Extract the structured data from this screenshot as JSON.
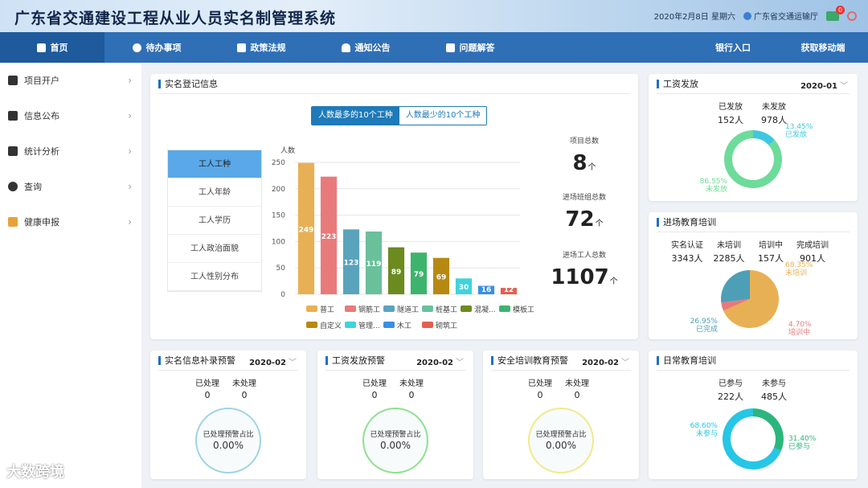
{
  "header": {
    "title": "广东省交通建设工程从业人员实名制管理系统",
    "date": "2020年2月8日",
    "weekday": "星期六",
    "org": "广东省交通运输厅",
    "msg_count": "0"
  },
  "nav": {
    "items": [
      "首页",
      "待办事项",
      "政策法规",
      "通知公告",
      "问题解答"
    ],
    "right": [
      "银行入口",
      "获取移动端"
    ]
  },
  "sidebar": {
    "items": [
      "项目开户",
      "信息公布",
      "统计分析",
      "查询",
      "健康申报"
    ]
  },
  "watermark": "大数跨境",
  "main": {
    "title": "实名登记信息",
    "tabs": [
      "人数最多的10个工种",
      "人数最少的10个工种"
    ],
    "categories": [
      "工人工种",
      "工人年龄",
      "工人学历",
      "工人政治面貌",
      "工人性别分布"
    ],
    "stats": [
      {
        "label": "项目总数",
        "value": "8",
        "unit": "个"
      },
      {
        "label": "进场班组总数",
        "value": "72",
        "unit": "个"
      },
      {
        "label": "进场工人总数",
        "value": "1107",
        "unit": "个"
      }
    ]
  },
  "chart_data": {
    "type": "bar",
    "ylabel": "人数",
    "ylim": [
      0,
      250
    ],
    "yticks": [
      0,
      50,
      100,
      150,
      200,
      250
    ],
    "grid": true,
    "categories": [
      "普工",
      "钢筋工",
      "隧道工",
      "桩基工",
      "混凝...",
      "模板工",
      "自定义",
      "管理...",
      "木工",
      "砌筑工"
    ],
    "values": [
      249,
      223,
      123,
      119,
      89,
      79,
      69,
      30,
      16,
      12
    ],
    "colors": [
      "#e8b054",
      "#e97a7a",
      "#5aa3bd",
      "#69c09a",
      "#6b8b1f",
      "#3db46d",
      "#b68a12",
      "#3fd3dc",
      "#3a8fe3",
      "#e35f4f"
    ],
    "legend_placement": "bottom"
  },
  "wage": {
    "title": "工资发放",
    "date": "2020-01",
    "labels": [
      "已发放",
      "未发放"
    ],
    "values": [
      "152人",
      "978人"
    ],
    "slices": [
      {
        "pct": "13.45%",
        "label": "已发放",
        "value": 13.45,
        "color": "#3ec8e0"
      },
      {
        "pct": "86.55%",
        "label": "未发放",
        "value": 86.55,
        "color": "#6ddb9a"
      }
    ]
  },
  "training": {
    "title": "进场教育培训",
    "labels": [
      "实名认证",
      "未培训",
      "培训中",
      "完成培训"
    ],
    "values": [
      "3343人",
      "2285人",
      "157人",
      "901人"
    ],
    "slices": [
      {
        "pct": "68.35%",
        "label": "未培训",
        "value": 68.35,
        "color": "#e8b054"
      },
      {
        "pct": "4.70%",
        "label": "培训中",
        "value": 4.7,
        "color": "#e97a7a"
      },
      {
        "pct": "26.95%",
        "label": "已完成",
        "value": 26.95,
        "color": "#4d9fb8"
      }
    ]
  },
  "daily": {
    "title": "日常教育培训",
    "labels": [
      "已参与",
      "未参与"
    ],
    "values": [
      "222人",
      "485人"
    ],
    "slices": [
      {
        "pct": "31.40%",
        "label": "已参与",
        "value": 31.4,
        "color": "#2cb67d"
      },
      {
        "pct": "68.60%",
        "label": "未参与",
        "value": 68.6,
        "color": "#26c6e6"
      }
    ]
  },
  "warnings": [
    {
      "title": "实名信息补录预警",
      "date": "2020-02",
      "labels": [
        "已处理",
        "未处理"
      ],
      "values": [
        "0",
        "0"
      ],
      "ring_label": "已处理预警占比",
      "ring_value": "0.00%",
      "color": "#9fd3e8"
    },
    {
      "title": "工资发放预警",
      "date": "2020-02",
      "labels": [
        "已处理",
        "未处理"
      ],
      "values": [
        "0",
        "0"
      ],
      "ring_label": "已处理预警占比",
      "ring_value": "0.00%",
      "color": "#8fe08f"
    },
    {
      "title": "安全培训教育预警",
      "date": "2020-02",
      "labels": [
        "已处理",
        "未处理"
      ],
      "values": [
        "0",
        "0"
      ],
      "ring_label": "已处理预警占比",
      "ring_value": "0.00%",
      "color": "#f0ea8a"
    }
  ]
}
